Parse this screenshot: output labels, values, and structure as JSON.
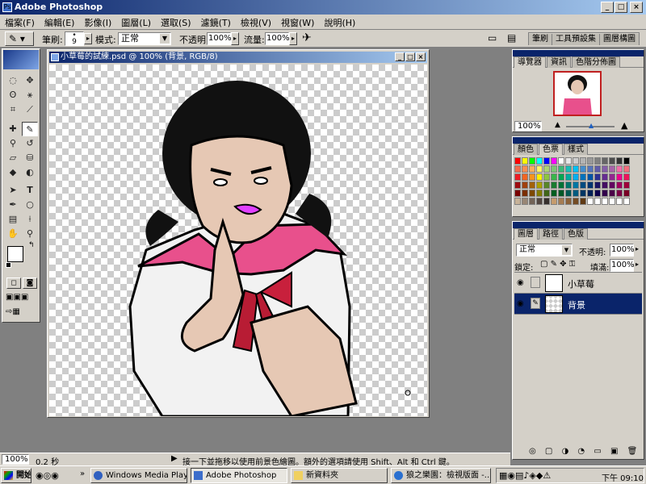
{
  "app": {
    "title": "Adobe Photoshop"
  },
  "menu": [
    "檔案(F)",
    "編輯(E)",
    "影像(I)",
    "圖層(L)",
    "選取(S)",
    "濾鏡(T)",
    "檢視(V)",
    "視窗(W)",
    "說明(H)"
  ],
  "options": {
    "brush_label": "筆刷:",
    "brush_size": "9",
    "mode_label": "模式:",
    "mode_value": "正常",
    "opacity_label": "不透明:",
    "opacity_value": "100%",
    "flow_label": "流量:",
    "flow_value": "100%",
    "palette_tabs": [
      "筆刷",
      "工具預設集",
      "圖層構圖"
    ]
  },
  "document": {
    "title": "小草莓的試練.psd @ 100% (背景, RGB/8)"
  },
  "navigator": {
    "tabs": [
      "導覽器",
      "資訊",
      "色階分佈圖"
    ],
    "zoom": "100%"
  },
  "swatches": {
    "tabs": [
      "顏色",
      "色票",
      "樣式"
    ],
    "colors": [
      [
        "#ff0000",
        "#ffff00",
        "#00ff00",
        "#00ffff",
        "#0000ff",
        "#ff00ff",
        "#ffffff",
        "#e6e6e6",
        "#cccccc",
        "#b3b3b3",
        "#999999",
        "#808080",
        "#666666",
        "#4d4d4d",
        "#333333",
        "#000000"
      ],
      [
        "#f26c4f",
        "#f68e55",
        "#fbaf5c",
        "#fff467",
        "#acd372",
        "#7cc576",
        "#3bb878",
        "#1abbb4",
        "#00bff3",
        "#438ccb",
        "#5574b9",
        "#605ca8",
        "#855fa8",
        "#a763a8",
        "#f06ea9",
        "#f26d7d"
      ],
      [
        "#ed1c24",
        "#f26522",
        "#f7941d",
        "#fff200",
        "#8dc63f",
        "#39b54a",
        "#00a651",
        "#00a99d",
        "#00aeef",
        "#0072bc",
        "#0054a6",
        "#2e3192",
        "#662d91",
        "#92278f",
        "#ec008c",
        "#ed145b"
      ],
      [
        "#9e0b0f",
        "#a0410d",
        "#a36209",
        "#aba000",
        "#598527",
        "#1a7b30",
        "#007236",
        "#00746b",
        "#0076a3",
        "#004b80",
        "#003471",
        "#1b1464",
        "#440e62",
        "#630460",
        "#9e005d",
        "#9e0039"
      ],
      [
        "#790000",
        "#7b2e00",
        "#7d4900",
        "#827b00",
        "#406618",
        "#005e20",
        "#005826",
        "#005952",
        "#005b7f",
        "#003663",
        "#002157",
        "#0d004c",
        "#32004b",
        "#4b0049",
        "#7b0046",
        "#7a0026"
      ],
      [
        "#c7b299",
        "#998675",
        "#736357",
        "#534741",
        "#37302d",
        "#c69c6d",
        "#a67c52",
        "#8c6239",
        "#754c24",
        "#603913",
        "#ffffff",
        "#ffffff",
        "#ffffff",
        "#ffffff",
        "#ffffff",
        "#ffffff"
      ]
    ]
  },
  "layers": {
    "tabs": [
      "圖層",
      "路徑",
      "色版"
    ],
    "mode": "正常",
    "opacity_label": "不透明:",
    "opacity_value": "100%",
    "lock_label": "鎖定:",
    "fill_label": "填滿:",
    "fill_value": "100%",
    "items": [
      {
        "name": "小草莓",
        "selected": false
      },
      {
        "name": "背景",
        "selected": true
      }
    ]
  },
  "status": {
    "zoom": "100%",
    "time": "0.2 秒",
    "hint": "接一下並拖移以使用前景色繪圖。額外的選項請使用 Shift、Alt 和 Ctrl 鍵。"
  },
  "taskbar": {
    "start": "開始",
    "tasks": [
      "Windows Media Player",
      "Adobe Photoshop",
      "新資料夾",
      "狼之樂園：檢視版面 -..."
    ],
    "clock": "下午 09:10"
  },
  "colors": {
    "title_dark": "#0a246a",
    "title_light": "#a6caf0",
    "face": "#d4d0c8",
    "selection": "#0a246a"
  }
}
